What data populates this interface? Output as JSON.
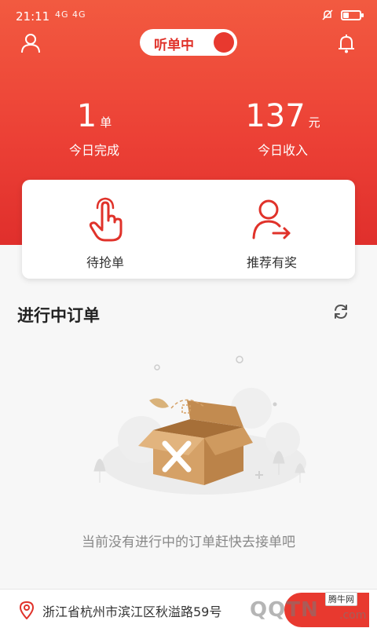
{
  "status_bar": {
    "time": "21:11",
    "signals": "4G 4G",
    "battery_level": 0.3
  },
  "header": {
    "listening_toggle_label": "听单中",
    "listening_on": true,
    "today_orders": {
      "value": "1",
      "unit": "单",
      "label": "今日完成"
    },
    "today_income": {
      "value": "137",
      "unit": "元",
      "label": "今日收入"
    }
  },
  "actions": [
    {
      "label": "待抢单",
      "icon": "tap-hand-icon"
    },
    {
      "label": "推荐有奖",
      "icon": "user-share-icon"
    }
  ],
  "orders": {
    "title": "进行中订单",
    "empty_text": "当前没有进行中的订单赶快去接单吧"
  },
  "bottom_bar": {
    "address": "浙江省杭州市滨江区秋溢路59号"
  },
  "watermark": {
    "small": "腾牛网",
    "big": "QQTN",
    "suffix": ".com"
  },
  "colors": {
    "primary": "#e8392f",
    "header_top": "#f25a40",
    "header_bottom": "#e02f2c"
  }
}
